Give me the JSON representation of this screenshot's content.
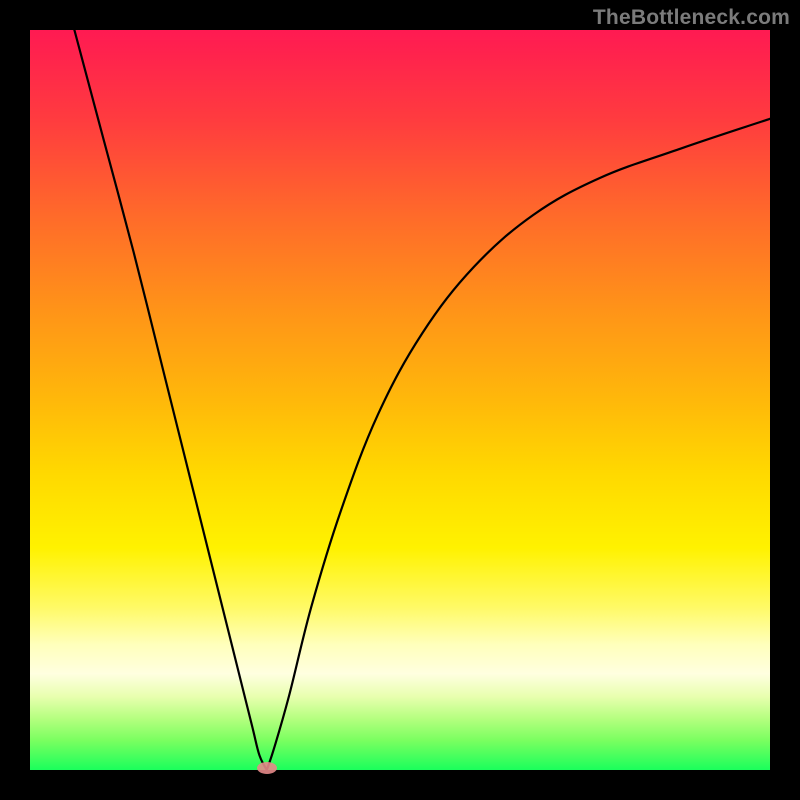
{
  "watermark": "TheBottleneck.com",
  "chart_data": {
    "type": "line",
    "title": "",
    "xlabel": "",
    "ylabel": "",
    "xlim": [
      0,
      100
    ],
    "ylim": [
      0,
      100
    ],
    "series": [
      {
        "name": "left-branch",
        "x": [
          6,
          10,
          14,
          18,
          22,
          26,
          28,
          30,
          31,
          32
        ],
        "values": [
          100,
          85,
          70,
          54,
          38,
          22,
          14,
          6,
          2,
          0
        ]
      },
      {
        "name": "right-branch",
        "x": [
          32,
          33,
          35,
          38,
          42,
          47,
          53,
          60,
          68,
          77,
          88,
          100
        ],
        "values": [
          0,
          3,
          10,
          22,
          35,
          48,
          59,
          68,
          75,
          80,
          84,
          88
        ]
      }
    ],
    "annotations": [
      {
        "name": "min-marker",
        "x": 32,
        "y": 0
      }
    ]
  },
  "colors": {
    "gradient_top": "#ff1a52",
    "gradient_bottom": "#1aff5c",
    "curve": "#000000",
    "marker": "#e58a8a",
    "frame": "#000000"
  }
}
